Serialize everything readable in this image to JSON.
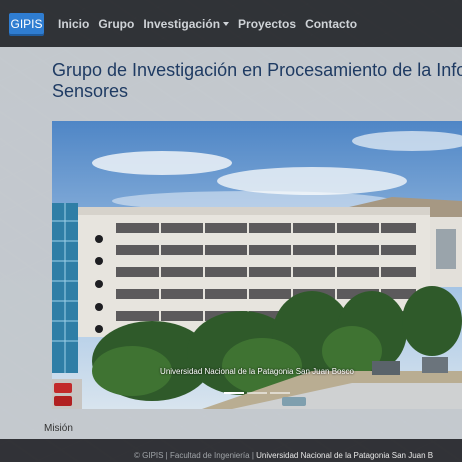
{
  "navbar": {
    "brand": "GIPIS",
    "items": [
      "Inicio",
      "Grupo",
      "Investigación",
      "Proyectos",
      "Contacto"
    ]
  },
  "main": {
    "title_line1": "Grupo de Investigación en Procesamiento de la Infor",
    "title_line2": "Sensores",
    "carousel": {
      "caption": "Universidad Nacional de la Patagonia San Juan Bosco"
    },
    "section_link": "Misión"
  },
  "footer": {
    "prefix": "© GIPIS | Facultad de Ingeniería | ",
    "university": "Universidad Nacional de la Patagonia San Juan B"
  }
}
